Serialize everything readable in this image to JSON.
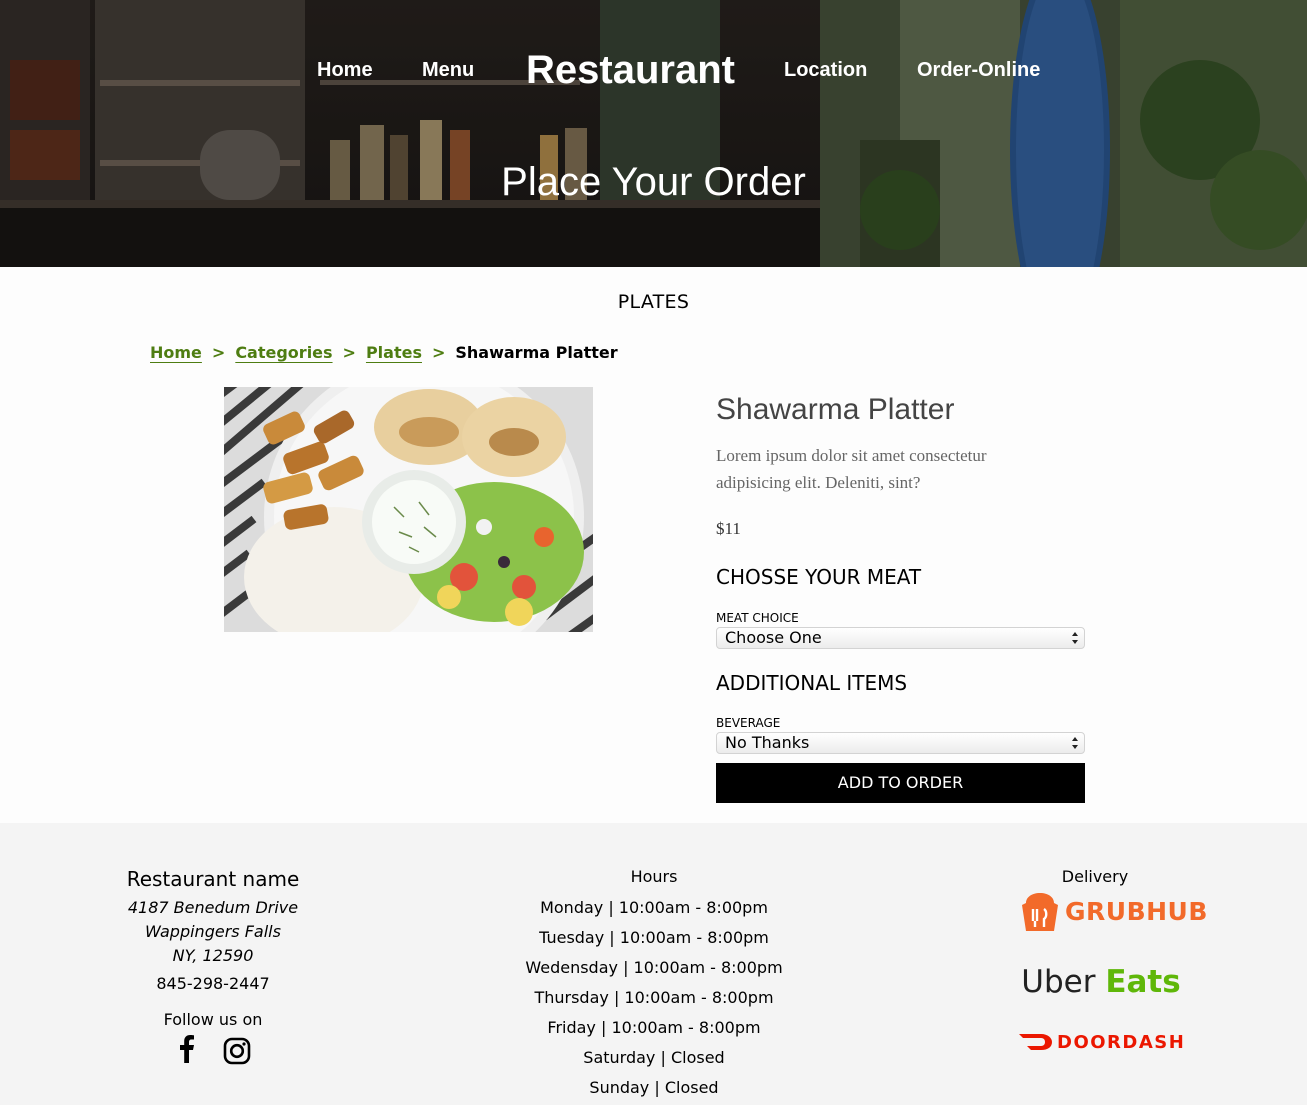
{
  "nav": {
    "home": "Home",
    "menu": "Menu",
    "brand": "Restaurant",
    "location": "Location",
    "order_online": "Order-Online"
  },
  "hero": {
    "title": "Place Your Order"
  },
  "section": {
    "title": "PLATES"
  },
  "breadcrumb": {
    "items": [
      "Home",
      "Categories",
      "Plates"
    ],
    "separator": ">",
    "current": "Shawarma Platter"
  },
  "product": {
    "name": "Shawarma Platter",
    "description": "Lorem ipsum dolor sit amet consectetur adipisicing elit. Deleniti, sint?",
    "price": "$11"
  },
  "options": {
    "meat_heading": "CHOSSE YOUR MEAT",
    "meat_label": "MEAT CHOICE",
    "meat_value": "Choose One",
    "additional_heading": "ADDITIONAL ITEMS",
    "beverage_label": "BEVERAGE",
    "beverage_value": "No Thanks",
    "add_button": "ADD TO ORDER"
  },
  "footer": {
    "restaurant_name": "Restaurant name",
    "address": [
      "4187 Benedum Drive",
      "Wappingers Falls",
      "NY, 12590"
    ],
    "phone": "845-298-2447",
    "follow": "Follow us on",
    "social_icons": [
      "facebook-icon",
      "instagram-icon"
    ],
    "hours_heading": "Hours",
    "hours": [
      "Monday | 10:00am - 8:00pm",
      "Tuesday | 10:00am - 8:00pm",
      "Wedensday | 10:00am - 8:00pm",
      "Thursday | 10:00am - 8:00pm",
      "Friday | 10:00am - 8:00pm",
      "Saturday | Closed",
      "Sunday | Closed"
    ],
    "delivery_heading": "Delivery",
    "delivery": {
      "grubhub": "GRUBHUB",
      "ubereats_a": "Uber",
      "ubereats_b": "Eats",
      "doordash": "DOORDASH"
    }
  },
  "colors": {
    "link_green": "#4e7d12",
    "button_black": "#000000",
    "footer_bg": "#f4f4f4",
    "grubhub": "#f26a2a",
    "ubereats_green": "#5fb709",
    "doordash": "#eb1700"
  }
}
